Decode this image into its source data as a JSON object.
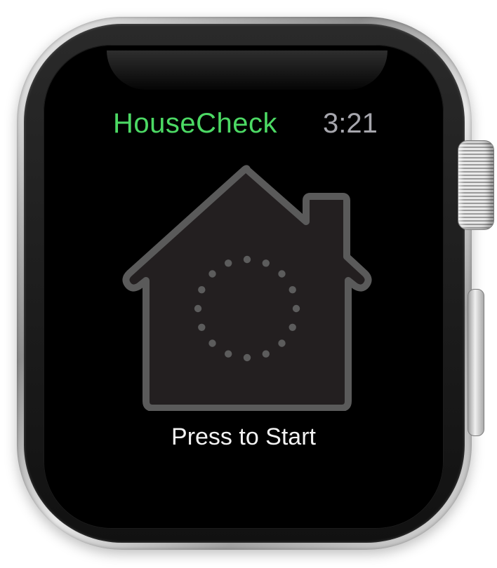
{
  "app": {
    "title": "HouseCheck",
    "time": "3:21",
    "start_label": "Press to Start"
  },
  "icons": {
    "home": "home-icon",
    "activity": "activity-spinner-icon",
    "crown": "digital-crown",
    "side_button": "side-button"
  },
  "colors": {
    "title": "#4cd964",
    "time": "#a6a6ad",
    "house_fill": "#231f20",
    "house_stroke": "#5a5a5a",
    "label": "#f2f2f2",
    "screen": "#000000"
  }
}
